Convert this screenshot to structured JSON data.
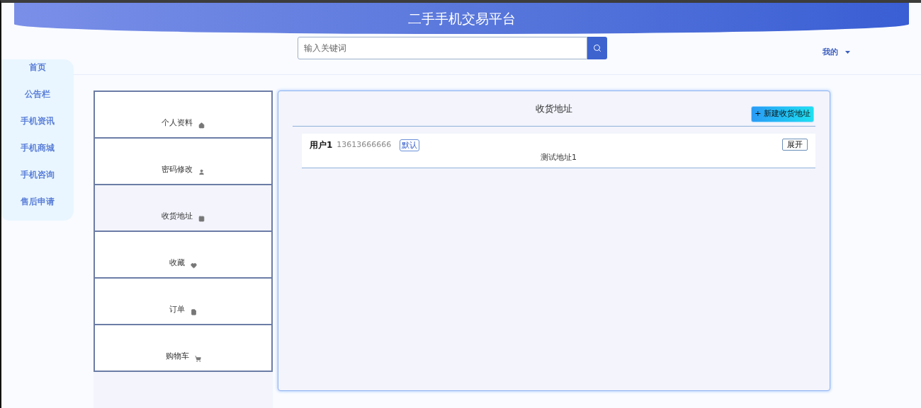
{
  "header": {
    "title": "二手手机交易平台"
  },
  "search": {
    "placeholder": "输入关键词"
  },
  "user_menu": {
    "label": "我的"
  },
  "nav": [
    {
      "label": "首页"
    },
    {
      "label": "公告栏"
    },
    {
      "label": "手机资讯"
    },
    {
      "label": "手机商城"
    },
    {
      "label": "手机咨询"
    },
    {
      "label": "售后申请"
    }
  ],
  "account_menu": [
    {
      "label": "个人资料",
      "selected": false
    },
    {
      "label": "密码修改",
      "selected": false
    },
    {
      "label": "收货地址",
      "selected": true
    },
    {
      "label": "收藏",
      "selected": false
    },
    {
      "label": "订单",
      "selected": false
    },
    {
      "label": "购物车",
      "selected": false
    }
  ],
  "panel": {
    "title": "收货地址",
    "new_button": "+ 新建收货地址",
    "addresses": [
      {
        "name": "用户1",
        "phone": "13613666666",
        "badge": "默认",
        "expand_button": "展开",
        "address": "测试地址1"
      }
    ]
  }
}
